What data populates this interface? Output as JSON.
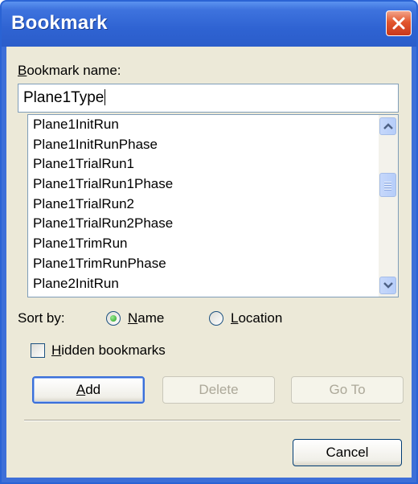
{
  "window": {
    "title": "Bookmark",
    "accent": "#2b5dca",
    "close_icon": "close-icon"
  },
  "bookmark_name": {
    "label_accel": "B",
    "label_rest": "ookmark name:",
    "value": "Plane1Type"
  },
  "bookmark_list": {
    "items": [
      "Plane1InitRun",
      "Plane1InitRunPhase",
      "Plane1TrialRun1",
      "Plane1TrialRun1Phase",
      "Plane1TrialRun2",
      "Plane1TrialRun2Phase",
      "Plane1TrimRun",
      "Plane1TrimRunPhase",
      "Plane2InitRun"
    ]
  },
  "sort": {
    "label": "Sort by:",
    "name_accel": "N",
    "name_rest": "ame",
    "location_accel": "L",
    "location_rest": "ocation",
    "selected": "Name"
  },
  "hidden_bookmarks": {
    "accel": "H",
    "rest": "idden bookmarks",
    "checked": false
  },
  "buttons": {
    "add_accel": "A",
    "add_rest": "dd",
    "delete": "Delete",
    "goto": "Go To",
    "cancel": "Cancel"
  }
}
